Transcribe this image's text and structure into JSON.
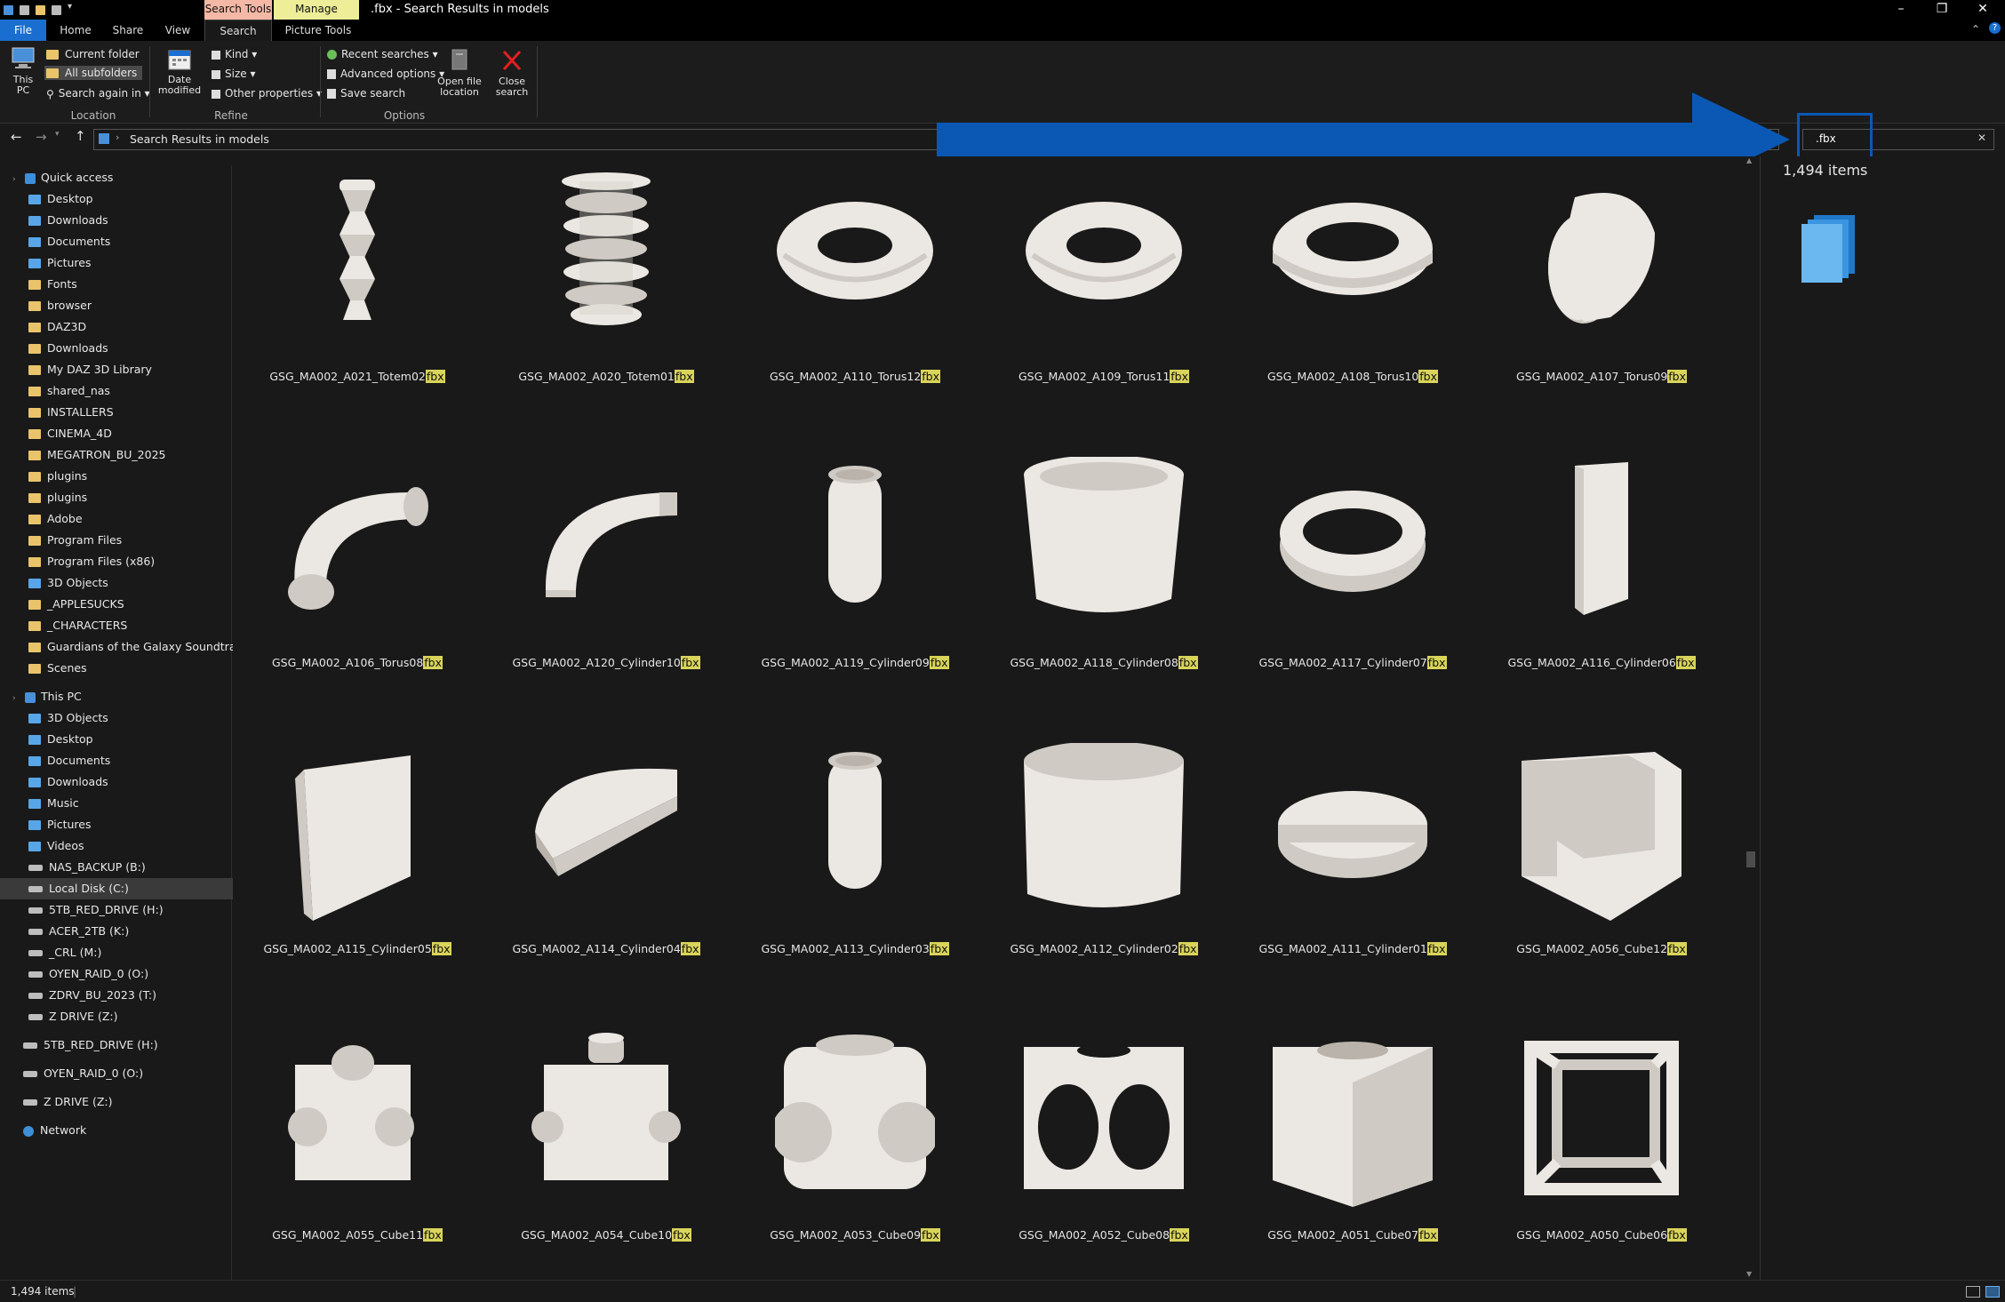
{
  "window": {
    "title": ".fbx - Search Results in models",
    "context_tabs": [
      {
        "label": "Search Tools",
        "color": "#f5b8a6"
      },
      {
        "label": "Manage",
        "color": "#eeee99"
      }
    ],
    "controls": {
      "minimize": "–",
      "restore": "❐",
      "close": "✕"
    }
  },
  "ribbon_tabs": [
    "File",
    "Home",
    "Share",
    "View",
    "Search",
    "Picture Tools"
  ],
  "ribbon": {
    "this_pc": "This PC",
    "current_folder": "Current folder",
    "all_subfolders": "All subfolders",
    "search_again_in": "Search again in",
    "location_group": "Location",
    "date_modified": "Date modified",
    "kind": "Kind",
    "size": "Size",
    "other_properties": "Other properties",
    "refine_group": "Refine",
    "recent_searches": "Recent searches",
    "advanced_options": "Advanced options",
    "save_search": "Save search",
    "open_file_location": "Open file location",
    "close_search": "Close search",
    "options_group": "Options"
  },
  "address": {
    "path": "Search Results in models",
    "search_value": ".fbx"
  },
  "sidebar": {
    "quick_access": "Quick access",
    "quick_items": [
      {
        "label": "Desktop",
        "icon": "desktop-folder-icon",
        "pinned": true
      },
      {
        "label": "Downloads",
        "icon": "downloads-folder-icon",
        "pinned": true
      },
      {
        "label": "Documents",
        "icon": "documents-folder-icon",
        "pinned": true
      },
      {
        "label": "Pictures",
        "icon": "pictures-folder-icon",
        "pinned": true
      },
      {
        "label": "Fonts",
        "icon": "folder-icon",
        "pinned": true
      },
      {
        "label": "browser",
        "icon": "folder-icon",
        "pinned": true
      },
      {
        "label": "DAZ3D",
        "icon": "folder-icon",
        "pinned": true
      },
      {
        "label": "Downloads",
        "icon": "folder-icon",
        "pinned": true
      },
      {
        "label": "My DAZ 3D Library",
        "icon": "folder-icon",
        "pinned": true
      },
      {
        "label": "shared_nas",
        "icon": "folder-icon",
        "pinned": true
      },
      {
        "label": "INSTALLERS",
        "icon": "folder-icon",
        "pinned": true
      },
      {
        "label": "CINEMA_4D",
        "icon": "folder-icon",
        "pinned": true
      },
      {
        "label": "MEGATRON_BU_2025",
        "icon": "folder-icon",
        "pinned": true
      },
      {
        "label": "plugins",
        "icon": "folder-icon",
        "pinned": true
      },
      {
        "label": "plugins",
        "icon": "folder-icon",
        "pinned": true
      },
      {
        "label": "Adobe",
        "icon": "folder-icon",
        "pinned": true
      },
      {
        "label": "Program Files",
        "icon": "folder-icon",
        "pinned": true
      },
      {
        "label": "Program Files (x86)",
        "icon": "folder-icon",
        "pinned": true
      },
      {
        "label": "3D Objects",
        "icon": "3d-objects-icon",
        "pinned": true
      },
      {
        "label": "_APPLESUCKS",
        "icon": "folder-icon",
        "pinned": false
      },
      {
        "label": "_CHARACTERS",
        "icon": "folder-icon",
        "pinned": false
      },
      {
        "label": "Guardians of the Galaxy Soundtrack - A",
        "icon": "folder-icon",
        "pinned": false
      },
      {
        "label": "Scenes",
        "icon": "folder-icon",
        "pinned": false
      }
    ],
    "this_pc": "This PC",
    "pc_items": [
      {
        "label": "3D Objects",
        "icon": "3d-objects-icon"
      },
      {
        "label": "Desktop",
        "icon": "desktop-folder-icon"
      },
      {
        "label": "Documents",
        "icon": "documents-folder-icon"
      },
      {
        "label": "Downloads",
        "icon": "downloads-folder-icon"
      },
      {
        "label": "Music",
        "icon": "music-folder-icon"
      },
      {
        "label": "Pictures",
        "icon": "pictures-folder-icon"
      },
      {
        "label": "Videos",
        "icon": "videos-folder-icon"
      },
      {
        "label": "NAS_BACKUP (B:)",
        "icon": "network-drive-icon"
      },
      {
        "label": "Local Disk (C:)",
        "icon": "local-disk-icon",
        "selected": true
      },
      {
        "label": "5TB_RED_DRIVE (H:)",
        "icon": "drive-icon"
      },
      {
        "label": "ACER_2TB (K:)",
        "icon": "drive-icon"
      },
      {
        "label": "_CRL (M:)",
        "icon": "drive-icon"
      },
      {
        "label": "OYEN_RAID_0 (O:)",
        "icon": "drive-icon"
      },
      {
        "label": "ZDRV_BU_2023 (T:)",
        "icon": "drive-icon"
      },
      {
        "label": "Z DRIVE (Z:)",
        "icon": "drive-icon"
      }
    ],
    "root_items": [
      {
        "label": "5TB_RED_DRIVE (H:)",
        "icon": "drive-icon"
      },
      {
        "label": "OYEN_RAID_0 (O:)",
        "icon": "drive-icon"
      },
      {
        "label": "Z DRIVE (Z:)",
        "icon": "drive-icon"
      },
      {
        "label": "Network",
        "icon": "network-icon"
      }
    ]
  },
  "files": [
    {
      "base": "GSG_MA002_A021_Totem02",
      "ext": "fbx",
      "shape": "totem2"
    },
    {
      "base": "GSG_MA002_A020_Totem01",
      "ext": "fbx",
      "shape": "totem1"
    },
    {
      "base": "GSG_MA002_A110_Torus12",
      "ext": "fbx",
      "shape": "torus-twist"
    },
    {
      "base": "GSG_MA002_A109_Torus11",
      "ext": "fbx",
      "shape": "torus-twist"
    },
    {
      "base": "GSG_MA002_A108_Torus10",
      "ext": "fbx",
      "shape": "torus-flat"
    },
    {
      "base": "GSG_MA002_A107_Torus09",
      "ext": "fbx",
      "shape": "torus-bend"
    },
    {
      "base": "GSG_MA002_A106_Torus08",
      "ext": "fbx",
      "shape": "torus-arc"
    },
    {
      "base": "GSG_MA002_A120_Cylinder10",
      "ext": "fbx",
      "shape": "arc"
    },
    {
      "base": "GSG_MA002_A119_Cylinder09",
      "ext": "fbx",
      "shape": "tube"
    },
    {
      "base": "GSG_MA002_A118_Cylinder08",
      "ext": "fbx",
      "shape": "cup"
    },
    {
      "base": "GSG_MA002_A117_Cylinder07",
      "ext": "fbx",
      "shape": "ring"
    },
    {
      "base": "GSG_MA002_A116_Cylinder06",
      "ext": "fbx",
      "shape": "slab"
    },
    {
      "base": "GSG_MA002_A115_Cylinder05",
      "ext": "fbx",
      "shape": "wedge"
    },
    {
      "base": "GSG_MA002_A114_Cylinder04",
      "ext": "fbx",
      "shape": "halfdisc"
    },
    {
      "base": "GSG_MA002_A113_Cylinder03",
      "ext": "fbx",
      "shape": "tube"
    },
    {
      "base": "GSG_MA002_A112_Cylinder02",
      "ext": "fbx",
      "shape": "cyl-big"
    },
    {
      "base": "GSG_MA002_A111_Cylinder01",
      "ext": "fbx",
      "shape": "disc"
    },
    {
      "base": "GSG_MA002_A056_Cube12",
      "ext": "fbx",
      "shape": "u-block"
    },
    {
      "base": "GSG_MA002_A055_Cube11",
      "ext": "fbx",
      "shape": "cube-dome"
    },
    {
      "base": "GSG_MA002_A054_Cube10",
      "ext": "fbx",
      "shape": "cube-pegs"
    },
    {
      "base": "GSG_MA002_A053_Cube09",
      "ext": "fbx",
      "shape": "cube-round"
    },
    {
      "base": "GSG_MA002_A052_Cube08",
      "ext": "fbx",
      "shape": "cube-holes"
    },
    {
      "base": "GSG_MA002_A051_Cube07",
      "ext": "fbx",
      "shape": "cube-hollow"
    },
    {
      "base": "GSG_MA002_A050_Cube06",
      "ext": "fbx",
      "shape": "cube-frame"
    }
  ],
  "preview": {
    "count": "1,494 items"
  },
  "status": {
    "count": "1,494 items"
  },
  "colors": {
    "accent": "#1a6ecf",
    "highlight": "#d9d45a",
    "arrow": "#0a58b4"
  }
}
